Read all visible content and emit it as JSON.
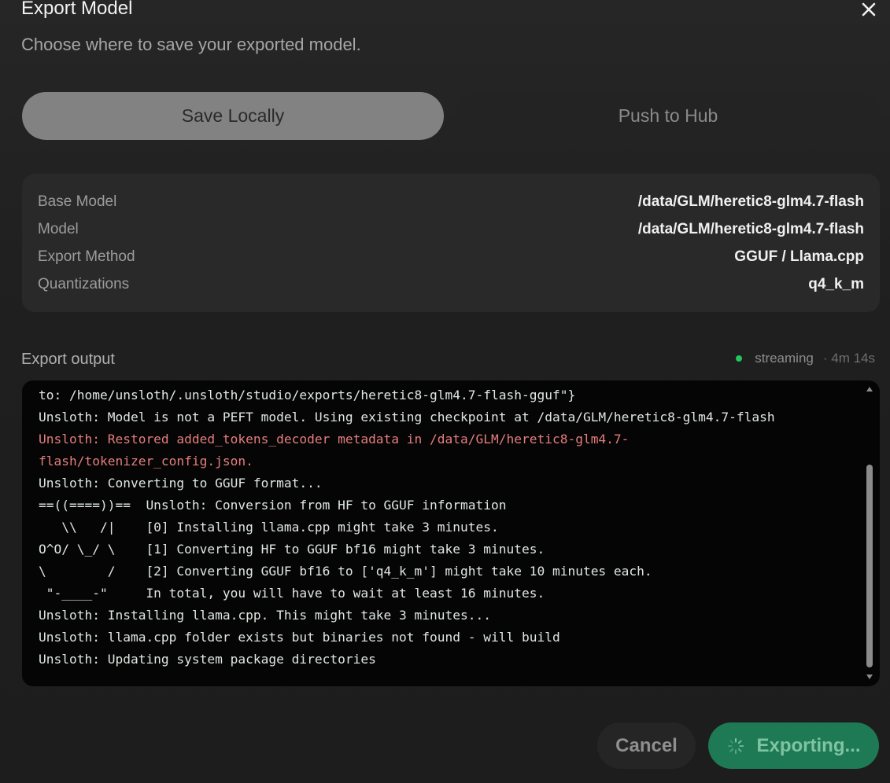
{
  "dialog": {
    "title": "Export Model",
    "subtitle": "Choose where to save your exported model."
  },
  "tabs": {
    "save_locally": "Save Locally",
    "push_to_hub": "Push to Hub",
    "selected": "Save Locally"
  },
  "summary": [
    {
      "label": "Base Model",
      "value": "/data/GLM/heretic8-glm4.7-flash"
    },
    {
      "label": "Model",
      "value": "/data/GLM/heretic8-glm4.7-flash"
    },
    {
      "label": "Export Method",
      "value": "GGUF / Llama.cpp"
    },
    {
      "label": "Quantizations",
      "value": "q4_k_m"
    }
  ],
  "output": {
    "label": "Export output",
    "status": "streaming",
    "elapsed": "· 4m 14s",
    "lines": [
      {
        "text": "to: /home/unsloth/.unsloth/studio/exports/heretic8-glm4.7-flash-gguf\"}",
        "kind": "normal"
      },
      {
        "text": "Unsloth: Model is not a PEFT model. Using existing checkpoint at /data/GLM/heretic8-glm4.7-flash",
        "kind": "normal"
      },
      {
        "text": "Unsloth: Restored added_tokens_decoder metadata in /data/GLM/heretic8-glm4.7-",
        "kind": "error"
      },
      {
        "text": "flash/tokenizer_config.json.",
        "kind": "error"
      },
      {
        "text": "Unsloth: Converting to GGUF format...",
        "kind": "normal"
      },
      {
        "text": "==((====))==  Unsloth: Conversion from HF to GGUF information",
        "kind": "normal"
      },
      {
        "text": "   \\\\   /|    [0] Installing llama.cpp might take 3 minutes.",
        "kind": "normal"
      },
      {
        "text": "O^O/ \\_/ \\    [1] Converting HF to GGUF bf16 might take 3 minutes.",
        "kind": "normal"
      },
      {
        "text": "\\        /    [2] Converting GGUF bf16 to ['q4_k_m'] might take 10 minutes each.",
        "kind": "normal"
      },
      {
        "text": " \"-____-\"     In total, you will have to wait at least 16 minutes.",
        "kind": "normal"
      },
      {
        "text": "Unsloth: Installing llama.cpp. This might take 3 minutes...",
        "kind": "normal"
      },
      {
        "text": "Unsloth: llama.cpp folder exists but binaries not found - will build",
        "kind": "normal"
      },
      {
        "text": "Unsloth: Updating system package directories",
        "kind": "normal"
      }
    ]
  },
  "actions": {
    "cancel": "Cancel",
    "export": "Exporting..."
  },
  "colors": {
    "accent": "#1e7a55",
    "status_dot": "#22c55e",
    "error_text": "#e57d7d"
  },
  "icons": {
    "close": "close-icon",
    "spinner": "spinner-icon"
  }
}
